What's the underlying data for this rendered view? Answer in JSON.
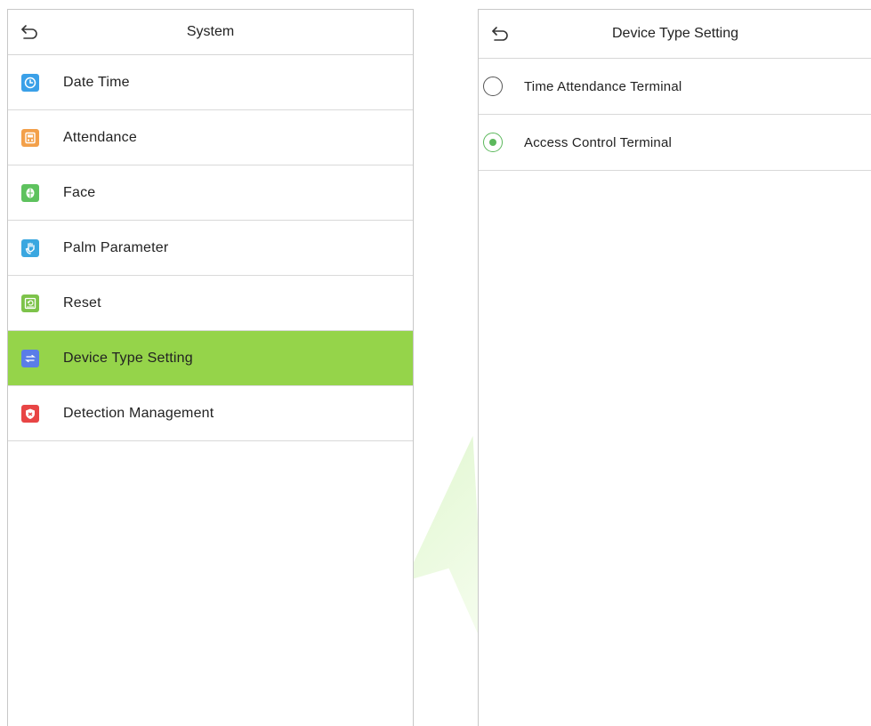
{
  "system_screen": {
    "title": "System",
    "back_icon": "back-arrow-icon",
    "items": [
      {
        "label": "Date Time",
        "icon": "clock-icon",
        "icon_color": "#3aa0e8"
      },
      {
        "label": "Attendance",
        "icon": "attendance-icon",
        "icon_color": "#f3a04a"
      },
      {
        "label": "Face",
        "icon": "face-icon",
        "icon_color": "#5ec25e"
      },
      {
        "label": "Palm Parameter",
        "icon": "palm-icon",
        "icon_color": "#3aa7e0"
      },
      {
        "label": "Reset",
        "icon": "reset-icon",
        "icon_color": "#7dc34a"
      },
      {
        "label": "Device Type Setting",
        "icon": "swap-icon",
        "icon_color": "#5a7de8",
        "selected": true
      },
      {
        "label": "Detection Management",
        "icon": "shield-icon",
        "icon_color": "#e84545"
      }
    ],
    "selected_color": "#95d44a"
  },
  "device_type_screen": {
    "title": "Device Type Setting",
    "back_icon": "back-arrow-icon",
    "options": [
      {
        "label": "Time Attendance Terminal",
        "checked": false
      },
      {
        "label": "Access Control Terminal",
        "checked": true
      }
    ],
    "radio_checked_color": "#5cb85c"
  }
}
